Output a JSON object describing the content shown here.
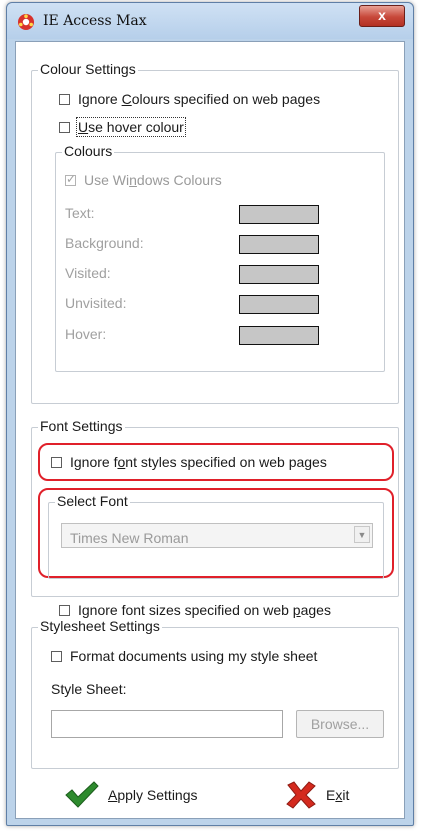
{
  "window": {
    "title": "IE Access Max",
    "close_label": "x"
  },
  "colour_settings": {
    "legend": "Colour Settings",
    "ignore_colours_pre": "Ignore ",
    "ignore_colours_key": "C",
    "ignore_colours_post": "olours specified on web pages",
    "ignore_colours_checked": false,
    "hover_pre": "",
    "hover_key": "U",
    "hover_post": "se hover colour",
    "hover_checked": false,
    "colours": {
      "legend": "Colours",
      "use_windows_pre": "Use Wi",
      "use_windows_key": "n",
      "use_windows_post": "dows Colours",
      "use_windows_checked": true,
      "items": [
        {
          "label": "Text:",
          "color": "#c6c6c6"
        },
        {
          "label": "Background:",
          "color": "#c6c6c6"
        },
        {
          "label": "Visited:",
          "color": "#c6c6c6"
        },
        {
          "label": "Unvisited:",
          "color": "#c6c6c6"
        },
        {
          "label": "Hover:",
          "color": "#c6c6c6"
        }
      ]
    }
  },
  "font_settings": {
    "legend": "Font Settings",
    "ignore_styles_pre": "Ignore f",
    "ignore_styles_key": "o",
    "ignore_styles_post": "nt styles specified on web pages",
    "ignore_styles_checked": false,
    "select_font_legend": "Select Font",
    "selected_font": "Times New Roman",
    "ignore_sizes_pre": "Ignore font sizes specified on web ",
    "ignore_sizes_key": "p",
    "ignore_sizes_post": "ages",
    "ignore_sizes_checked": false
  },
  "stylesheet_settings": {
    "legend": "Stylesheet Settings",
    "format_label": "Format documents using my style sheet",
    "format_checked": false,
    "style_sheet_label": "Style Sheet:",
    "style_sheet_value": "",
    "browse_label": "Browse..."
  },
  "actions": {
    "apply_key": "A",
    "apply_post": "pply Settings",
    "exit_pre": "E",
    "exit_key": "x",
    "exit_post": "it"
  },
  "colors": {
    "highlight": "#e0202a",
    "apply_icon": "#2e8b2e",
    "exit_icon": "#d42a1e"
  }
}
